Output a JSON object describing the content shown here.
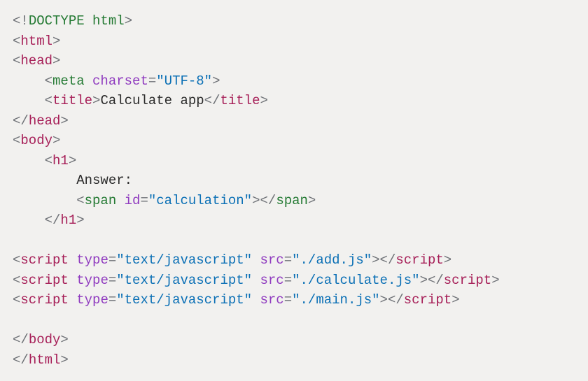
{
  "code": {
    "doctype": "<!DOCTYPE html>",
    "tag_html_open": "html",
    "tag_html_close": "html",
    "tag_head_open": "head",
    "tag_head_close": "head",
    "tag_body_open": "body",
    "tag_body_close": "body",
    "meta": {
      "tag": "meta",
      "attr": "charset",
      "val": "\"UTF-8\""
    },
    "title": {
      "tag": "title",
      "text": "Calculate app"
    },
    "h1": {
      "tag": "h1",
      "text": "Answer:"
    },
    "span": {
      "tag": "span",
      "attr": "id",
      "val": "\"calculation\""
    },
    "script1": {
      "tag": "script",
      "type_attr": "type",
      "type_val": "\"text/javascript\"",
      "src_attr": "src",
      "src_val": "\"./add.js\""
    },
    "script2": {
      "tag": "script",
      "type_attr": "type",
      "type_val": "\"text/javascript\"",
      "src_attr": "src",
      "src_val": "\"./calculate.js\""
    },
    "script3": {
      "tag": "script",
      "type_attr": "type",
      "type_val": "\"text/javascript\"",
      "src_attr": "src",
      "src_val": "\"./main.js\""
    }
  }
}
